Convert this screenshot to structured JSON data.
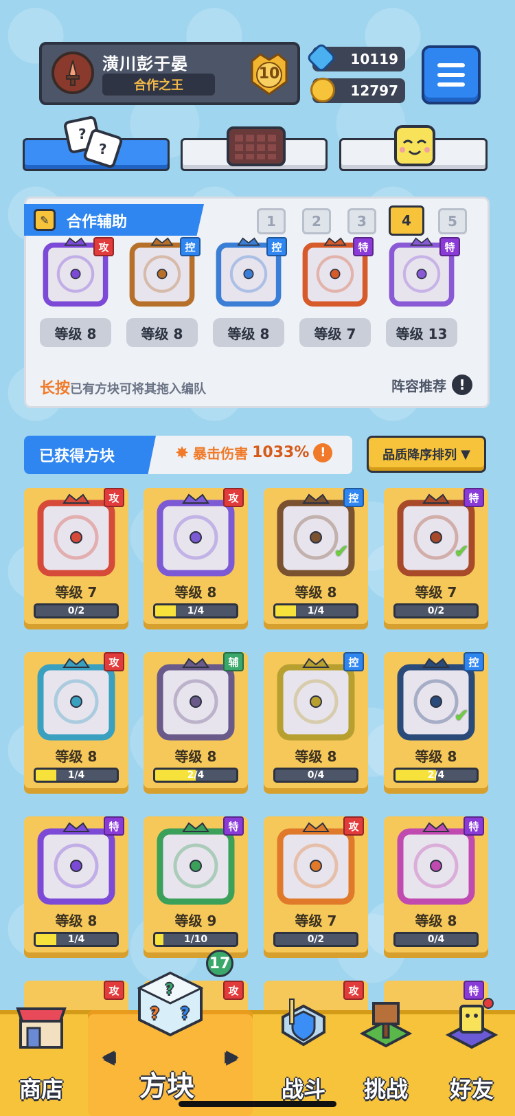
{
  "profile": {
    "name": "潢川彭于晏",
    "title": "合作之王",
    "rank_level": "10",
    "gems": "10119",
    "coins": "12797"
  },
  "assist": {
    "heading": "合作辅助",
    "pages": [
      "1",
      "2",
      "3",
      "4",
      "5"
    ],
    "selected_page": "4",
    "slots": [
      {
        "type_label": "攻",
        "type": "attack",
        "level": "等级 8",
        "color": "#7c4ad6"
      },
      {
        "type_label": "控",
        "type": "control",
        "level": "等级 8",
        "color": "#b7702a"
      },
      {
        "type_label": "控",
        "type": "control",
        "level": "等级 8",
        "color": "#3b7ed6"
      },
      {
        "type_label": "特",
        "type": "special",
        "level": "等级 7",
        "color": "#d65a2a"
      },
      {
        "type_label": "特",
        "type": "special",
        "level": "等级 13",
        "color": "#8a5ad6"
      }
    ],
    "hint_emphasis": "长按",
    "hint_text": "已有方块可将其拖入编队",
    "recommend": "阵容推荐"
  },
  "owned": {
    "heading": "已获得方块",
    "crit_label": "暴击伤害",
    "crit_value": "1033%",
    "sort_label": "品质降序排列"
  },
  "cards": [
    {
      "type_label": "攻",
      "type": "attack",
      "level": "等级 7",
      "progress": "0/2",
      "fill": 0,
      "color": "#d64a3a",
      "checked": false
    },
    {
      "type_label": "攻",
      "type": "attack",
      "level": "等级 8",
      "progress": "1/4",
      "fill": 0.25,
      "color": "#7c5ad6",
      "checked": false
    },
    {
      "type_label": "控",
      "type": "control",
      "level": "等级 8",
      "progress": "1/4",
      "fill": 0.25,
      "color": "#7a5230",
      "checked": true
    },
    {
      "type_label": "特",
      "type": "special",
      "level": "等级 7",
      "progress": "0/2",
      "fill": 0,
      "color": "#a84a2a",
      "checked": true
    },
    {
      "type_label": "攻",
      "type": "attack",
      "level": "等级 8",
      "progress": "1/4",
      "fill": 0.25,
      "color": "#3aa0c0",
      "checked": false
    },
    {
      "type_label": "辅",
      "type": "support",
      "level": "等级 8",
      "progress": "2/4",
      "fill": 0.5,
      "color": "#6a5a8a",
      "checked": false
    },
    {
      "type_label": "控",
      "type": "control",
      "level": "等级 8",
      "progress": "0/4",
      "fill": 0,
      "color": "#b8a030",
      "checked": false
    },
    {
      "type_label": "控",
      "type": "control",
      "level": "等级 8",
      "progress": "2/4",
      "fill": 0.5,
      "color": "#2a4a7a",
      "checked": true
    },
    {
      "type_label": "特",
      "type": "special",
      "level": "等级 8",
      "progress": "1/4",
      "fill": 0.25,
      "color": "#7c4ad6",
      "checked": false
    },
    {
      "type_label": "特",
      "type": "special",
      "level": "等级 9",
      "progress": "1/10",
      "fill": 0.1,
      "color": "#3aa05a",
      "checked": false
    },
    {
      "type_label": "攻",
      "type": "attack",
      "level": "等级 7",
      "progress": "0/2",
      "fill": 0,
      "color": "#e07a2a",
      "checked": false
    },
    {
      "type_label": "特",
      "type": "special",
      "level": "等级 8",
      "progress": "0/4",
      "fill": 0,
      "color": "#c04ab0",
      "checked": false
    }
  ],
  "partial_row_badges": [
    "攻",
    "攻",
    "攻",
    "特"
  ],
  "nav": {
    "shop": "商店",
    "blocks": "方块",
    "blocks_count": "17",
    "battle": "战斗",
    "challenge": "挑战",
    "friends": "好友"
  }
}
